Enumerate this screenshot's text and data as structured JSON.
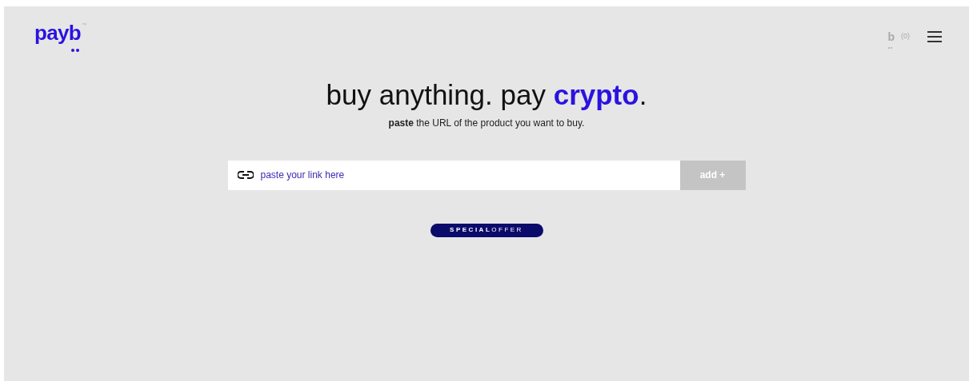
{
  "header": {
    "logo": "payb",
    "trademark": "™",
    "cart": {
      "letter": "b",
      "count": "(0)"
    }
  },
  "hero": {
    "headline": "buy anything. pay **crypto**.",
    "subtitle": "**paste** the URL of the product you want to buy."
  },
  "link_form": {
    "placeholder": "paste your link here",
    "button": "add +"
  },
  "badge": "**SPECIAL**OFFER"
}
